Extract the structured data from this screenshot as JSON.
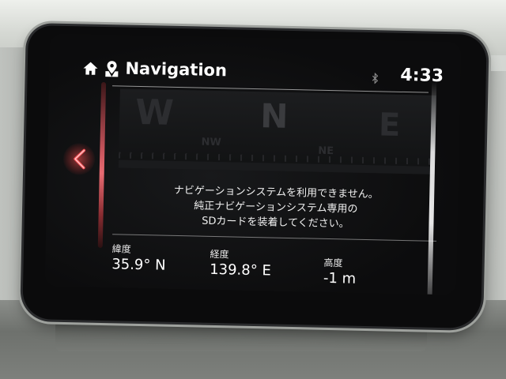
{
  "header": {
    "title": "Navigation",
    "clock": "4:33",
    "icons": [
      "home-icon",
      "nav-pin-icon",
      "bluetooth-icon"
    ]
  },
  "compass": {
    "labels": {
      "w": "W",
      "nw": "NW",
      "n": "N",
      "ne": "NE",
      "e": "E"
    }
  },
  "message": {
    "lines": [
      "ナビゲーションシステムを利用できません。",
      "純正ナビゲーションシステム専用の",
      "SDカードを装着してください。"
    ]
  },
  "readouts": {
    "latitude": {
      "label": "緯度",
      "value": "35.9° N"
    },
    "longitude": {
      "label": "経度",
      "value": "139.8° E"
    },
    "altitude": {
      "label": "高度",
      "value": "-1 m"
    }
  },
  "colors": {
    "accent_red": "#e0454e",
    "text": "#ffffff",
    "screen_bg": "#0c0c0d"
  }
}
